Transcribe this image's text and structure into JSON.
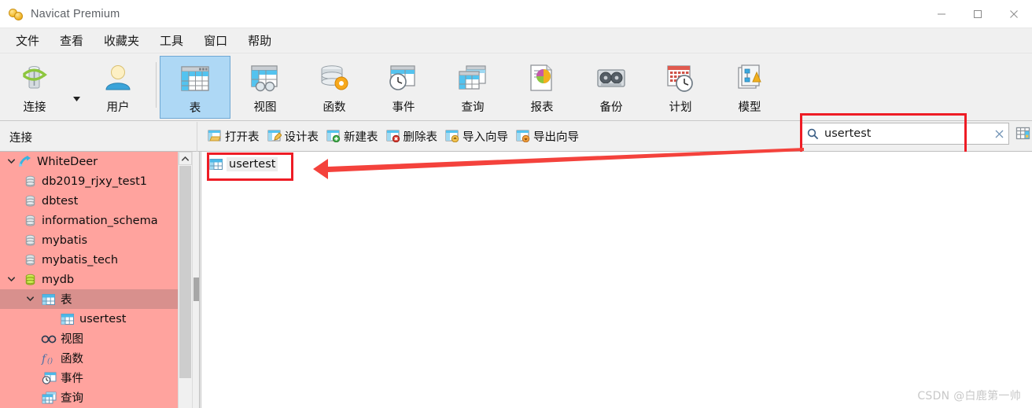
{
  "window": {
    "title": "Navicat Premium",
    "logo_icon": "navicat-logo-icon",
    "minimize_label": "—",
    "maximize_label": "□",
    "close_label": "✕"
  },
  "menubar": {
    "items": [
      {
        "label": "文件"
      },
      {
        "label": "查看"
      },
      {
        "label": "收藏夹"
      },
      {
        "label": "工具"
      },
      {
        "label": "窗口"
      },
      {
        "label": "帮助"
      }
    ]
  },
  "ribbon": {
    "buttons": [
      {
        "label": "连接",
        "icon": "connection-icon",
        "selected": false,
        "has_dropdown": true
      },
      {
        "label": "用户",
        "icon": "user-icon",
        "selected": false,
        "has_dropdown": false
      },
      {
        "label": "表",
        "icon": "table-icon",
        "selected": true,
        "has_dropdown": false
      },
      {
        "label": "视图",
        "icon": "view-icon",
        "selected": false,
        "has_dropdown": false
      },
      {
        "label": "函数",
        "icon": "function-icon",
        "selected": false,
        "has_dropdown": false
      },
      {
        "label": "事件",
        "icon": "event-icon",
        "selected": false,
        "has_dropdown": false
      },
      {
        "label": "查询",
        "icon": "query-icon",
        "selected": false,
        "has_dropdown": false
      },
      {
        "label": "报表",
        "icon": "report-icon",
        "selected": false,
        "has_dropdown": false
      },
      {
        "label": "备份",
        "icon": "backup-icon",
        "selected": false,
        "has_dropdown": false
      },
      {
        "label": "计划",
        "icon": "schedule-icon",
        "selected": false,
        "has_dropdown": false
      },
      {
        "label": "模型",
        "icon": "model-icon",
        "selected": false,
        "has_dropdown": false
      }
    ]
  },
  "subbar": {
    "connection_panel_label": "连接",
    "actions": [
      {
        "label": "打开表",
        "icon": "open-table-icon"
      },
      {
        "label": "设计表",
        "icon": "design-table-icon"
      },
      {
        "label": "新建表",
        "icon": "new-table-icon"
      },
      {
        "label": "删除表",
        "icon": "delete-table-icon"
      },
      {
        "label": "导入向导",
        "icon": "import-wizard-icon"
      },
      {
        "label": "导出向导",
        "icon": "export-wizard-icon"
      }
    ]
  },
  "search": {
    "value": "usertest",
    "placeholder": "",
    "search_icon": "search-icon",
    "clear_icon": "close-icon",
    "grid_toggle_icon": "grid-view-icon"
  },
  "sidebar": {
    "tree": [
      {
        "label": "WhiteDeer",
        "icon": "connection-link-icon",
        "indent": 0,
        "twisty": "expanded",
        "selected": false
      },
      {
        "label": "db2019_rjxy_test1",
        "icon": "database-icon",
        "indent": 1,
        "twisty": "none",
        "selected": false
      },
      {
        "label": "dbtest",
        "icon": "database-icon",
        "indent": 1,
        "twisty": "none",
        "selected": false
      },
      {
        "label": "information_schema",
        "icon": "database-icon",
        "indent": 1,
        "twisty": "none",
        "selected": false
      },
      {
        "label": "mybatis",
        "icon": "database-icon",
        "indent": 1,
        "twisty": "none",
        "selected": false
      },
      {
        "label": "mybatis_tech",
        "icon": "database-icon",
        "indent": 1,
        "twisty": "none",
        "selected": false
      },
      {
        "label": "mydb",
        "icon": "database-active-icon",
        "indent": 1,
        "twisty": "expanded",
        "selected": false
      },
      {
        "label": "表",
        "icon": "table-folder-icon",
        "indent": 2,
        "twisty": "expanded",
        "selected": true
      },
      {
        "label": "usertest",
        "icon": "table-folder-icon",
        "indent": 3,
        "twisty": "none",
        "selected": false
      },
      {
        "label": "视图",
        "icon": "view-glasses-icon",
        "indent": 2,
        "twisty": "none",
        "selected": false
      },
      {
        "label": "函数",
        "icon": "function-fx-icon",
        "indent": 2,
        "twisty": "none",
        "selected": false
      },
      {
        "label": "事件",
        "icon": "event-clock-icon",
        "indent": 2,
        "twisty": "none",
        "selected": false
      },
      {
        "label": "查询",
        "icon": "query-grid-icon",
        "indent": 2,
        "twisty": "none",
        "selected": false
      }
    ],
    "scroll_up_icon": "chevron-up-icon"
  },
  "content": {
    "items": [
      {
        "label": "usertest",
        "icon": "table-item-icon",
        "selected": true
      }
    ]
  },
  "annotations": {
    "highlight_color": "#ee1c25",
    "arrow_color": "#f4423c",
    "arrow_description": "arrow from search box to usertest result"
  },
  "watermark": {
    "text": "CSDN @白鹿第一帅"
  }
}
